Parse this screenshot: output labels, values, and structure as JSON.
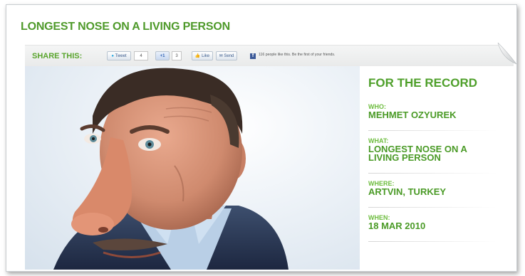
{
  "page": {
    "title": "LONGEST NOSE ON A LIVING PERSON"
  },
  "share": {
    "label": "SHARE THIS:",
    "tweet_label": "Tweet",
    "tweet_count": "4",
    "gplus_label": "+1",
    "gplus_count": "3",
    "like_label": "Like",
    "send_label": "Send",
    "facebook_text": "116 people like this. Be the first of your friends."
  },
  "record": {
    "heading": "FOR THE RECORD",
    "fields": [
      {
        "label": "WHO:",
        "value": "MEHMET OZYUREK"
      },
      {
        "label": "WHAT:",
        "value": "LONGEST NOSE ON A LIVING PERSON"
      },
      {
        "label": "WHERE:",
        "value": "ARTVIN, TURKEY"
      },
      {
        "label": "WHEN:",
        "value": "18 MAR 2010"
      }
    ]
  },
  "colors": {
    "brand_green": "#4e9f2a",
    "label_green": "#6ebd3f",
    "facebook_blue": "#3b5998"
  },
  "icons": {
    "facebook": "facebook-f-icon",
    "twitter": "twitter-bird-icon",
    "corner": "page-curl-icon"
  },
  "image": {
    "subject": "portrait-photo"
  }
}
